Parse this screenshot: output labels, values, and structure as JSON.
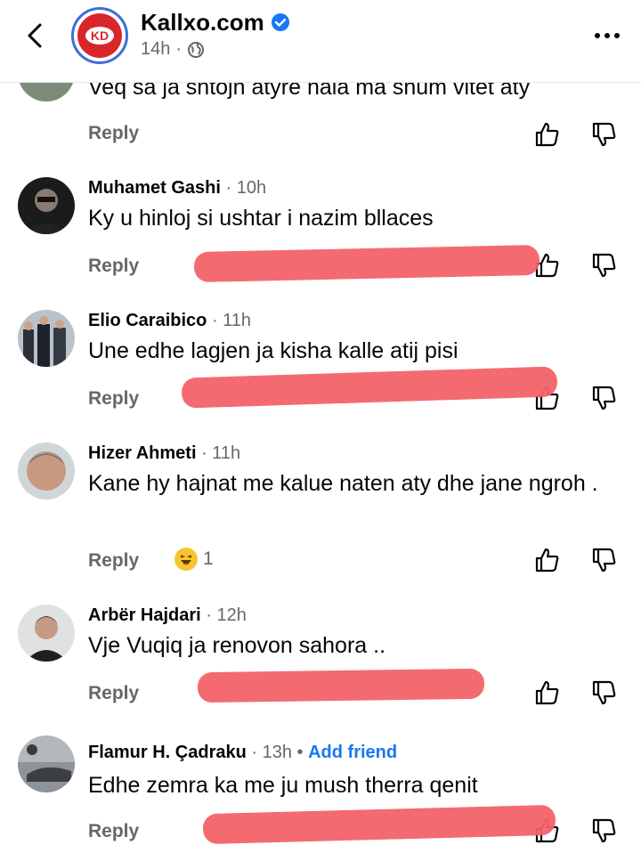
{
  "header": {
    "page_name": "Kallxo.com",
    "time": "14h",
    "separator": "·",
    "logo_text": "KD"
  },
  "first_comment": {
    "text": "Veq sa ja shtojn atyre hala ma shum vitet aty",
    "reply_label": "Reply"
  },
  "comments": [
    {
      "author": "Muhamet Gashi",
      "time": "10h",
      "text": "Ky u hinloj si ushtar i nazim bllaces",
      "reply_label": "Reply"
    },
    {
      "author": "Elio Caraibico",
      "time": "11h",
      "text": "Une edhe lagjen ja kisha kalle atij pisi",
      "reply_label": "Reply"
    },
    {
      "author": "Hizer Ahmeti",
      "time": "11h",
      "text": "Kane hy hajnat me kalue naten aty dhe jane ngroh .",
      "reply_label": "Reply",
      "reaction_count": "1"
    },
    {
      "author": "Arbër Hajdari",
      "time": "12h",
      "text": "Vje Vuqiq ja renovon sahora ..",
      "reply_label": "Reply"
    },
    {
      "author": "Flamur H. Çadraku",
      "time": "13h",
      "text": "Edhe zemra ka me ju mush therra qenit",
      "reply_label": "Reply",
      "add_friend": "Add friend"
    }
  ],
  "colors": {
    "accent": "#1877f2",
    "redaction": "#f26369",
    "secondary_text": "#65676b"
  }
}
